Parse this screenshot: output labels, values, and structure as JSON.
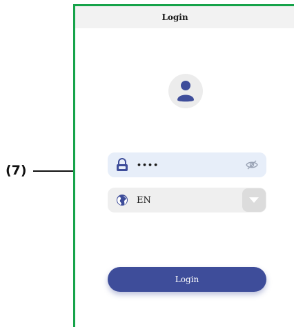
{
  "annotation": {
    "label": "(7)"
  },
  "header": {
    "title": "Login"
  },
  "password": {
    "value": "••••"
  },
  "language": {
    "selected": "EN"
  },
  "login_button": {
    "label": "Login"
  },
  "icons": {
    "avatar": "user-icon",
    "password_lead": "lock-icon",
    "password_toggle": "eye-off-icon",
    "language_lead": "globe-icon",
    "language_toggle": "chevron-down-icon"
  },
  "colors": {
    "frame_border": "#16a34a",
    "header_bg": "#f2f2f2",
    "accent": "#3e4d9a",
    "password_field_bg": "#e7eef9",
    "language_field_bg": "#efefef"
  }
}
